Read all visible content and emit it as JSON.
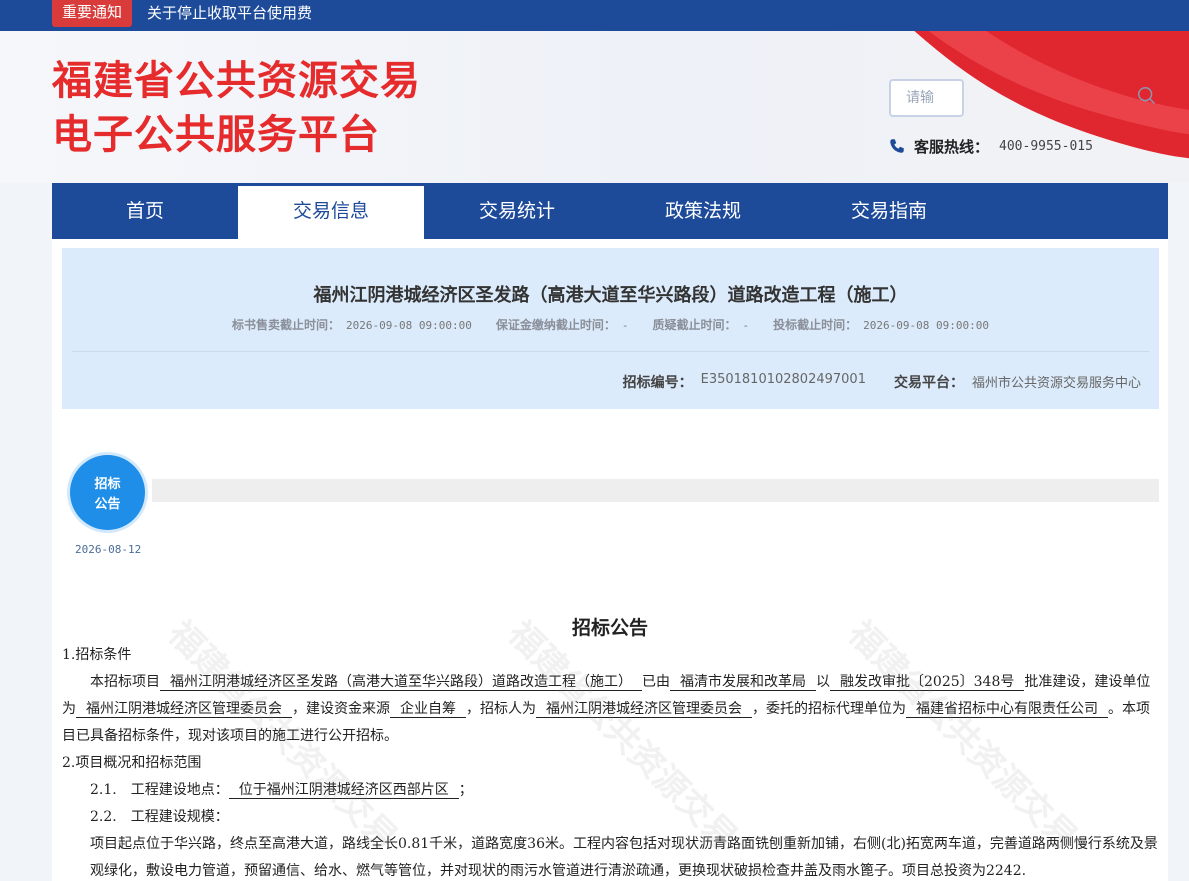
{
  "notice": {
    "tag": "重要通知",
    "text": "关于停止收取平台使用费"
  },
  "header": {
    "logo_line1": "福建省公共资源交易",
    "logo_line2": "电子公共服务平台",
    "search_placeholder": "请输",
    "hotline_label": "客服热线：",
    "hotline_number": "400-9955-015"
  },
  "nav": {
    "home": "首页",
    "trade_info": "交易信息",
    "trade_stats": "交易统计",
    "policy": "政策法规",
    "guide": "交易指南"
  },
  "project": {
    "title": "福州江阴港城经济区圣发路（高港大道至华兴路段）道路改造工程（施工）",
    "sale_deadline_label": "标书售卖截止时间：",
    "sale_deadline_value": "2026-09-08 09:00:00",
    "deposit_deadline_label": "保证金缴纳截止时间：",
    "deposit_deadline_value": "-",
    "query_deadline_label": "质疑截止时间：",
    "query_deadline_value": "-",
    "bid_deadline_label": "投标截止时间：",
    "bid_deadline_value": "2026-09-08 09:00:00",
    "code_label": "招标编号：",
    "code_value": "E3501810102802497001",
    "platform_label": "交易平台：",
    "platform_value": "福州市公共资源交易服务中心"
  },
  "timeline": {
    "stage_line1": "招标",
    "stage_line2": "公告",
    "stage_date": "2026-08-12"
  },
  "announcement": {
    "title": "招标公告",
    "s1": "1.招标条件",
    "p1_a": "本招标项目",
    "p1_project": "福州江阴港城经济区圣发路（高港大道至华兴路段）道路改造工程（施工）",
    "p1_b": "已由",
    "p1_approver": "福清市发展和改革局",
    "p1_c": "以",
    "p1_doc": "融发改审批〔2025〕348号",
    "p1_d": "批准建设，建设单位为",
    "p1_owner": "福州江阴港城经济区管理委员会",
    "p1_e": "，建设资金来源",
    "p1_fund": "企业自筹",
    "p1_f": "，招标人为",
    "p1_tenderer": "福州江阴港城经济区管理委员会",
    "p1_g": "，委托的招标代理单位为",
    "p1_agent": "福建省招标中心有限责任公司",
    "p1_h": "。本项目已具备招标条件，现对该项目的施工进行公开招标。",
    "s2": "2.项目概况和招标范围",
    "s2_1_label": "2.1.　工程建设地点：",
    "s2_1_value": "位于福州江阴港城经济区西部片区",
    "s2_1_end": "；",
    "s2_2_label": "2.2.　工程建设规模：",
    "scale_text": "项目起点位于华兴路，终点至高港大道，路线全长0.81千米，道路宽度36米。工程内容包括对现状沥青路面铣刨重新加铺，右侧(北)拓宽两车道，完善道路两侧慢行系统及景观绿化，敷设电力管道，预留通信、给水、燃气等管位，并对现状的雨污水管道进行清淤疏通，更换现状破损检查井盖及雨水篦子。项目总投资为2242."
  }
}
